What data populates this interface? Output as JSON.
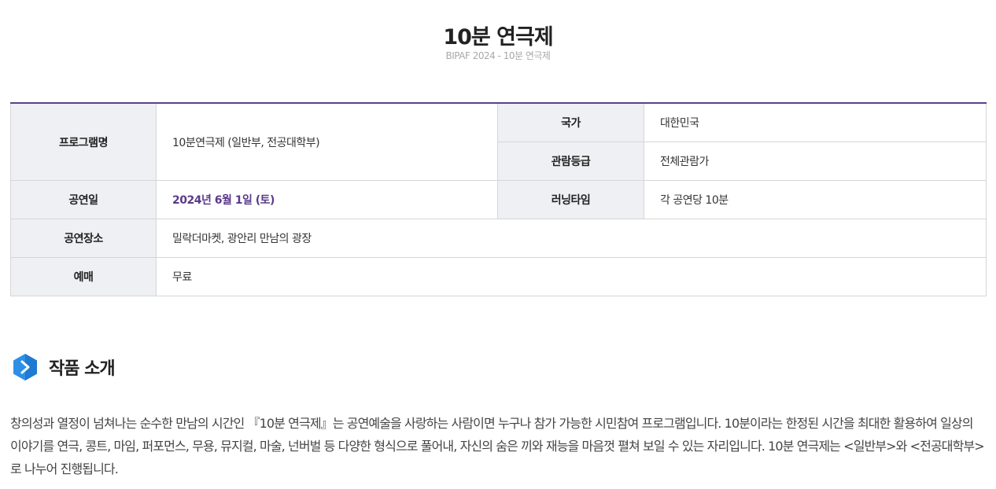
{
  "header": {
    "title": "10분 연극제",
    "subtitle": "BIPAF 2024 - 10분 연극제"
  },
  "info": {
    "program_label": "프로그램명",
    "program_value": "10분연극제 (일반부, 전공대학부)",
    "country_label": "국가",
    "country_value": "대한민국",
    "rating_label": "관람등급",
    "rating_value": "전체관람가",
    "date_label": "공연일",
    "date_value": "2024년 6월 1일 (토)",
    "runtime_label": "러닝타임",
    "runtime_value": "각 공연당 10분",
    "venue_label": "공연장소",
    "venue_value": "밀락더마켓, 광안리 만남의 광장",
    "ticket_label": "예매",
    "ticket_value": "무료"
  },
  "section": {
    "icon": "hexagon-chevron-icon",
    "title": "작품 소개",
    "body": "창의성과 열정이 넘쳐나는 순수한 만남의 시간인 『10분 연극제』는 공연예술을 사랑하는 사람이면 누구나 참가 가능한 시민참여 프로그램입니다. 10분이라는 한정된 시간을 최대한 활용하여 일상의 이야기를 연극, 콩트, 마임, 퍼포먼스, 무용, 뮤지컬, 마술, 넌버벌 등 다양한 형식으로 풀어내, 자신의 숨은 끼와 재능을 마음껏 펼쳐 보일 수 있는 자리입니다. 10분 연극제는 <일반부>와 <전공대학부>로 나누어 진행됩니다."
  },
  "colors": {
    "accent": "#5c3f8e",
    "date_text": "#5a3a8a",
    "header_cell_bg": "#eef0f3",
    "icon_blue": "#2e8fe6"
  }
}
